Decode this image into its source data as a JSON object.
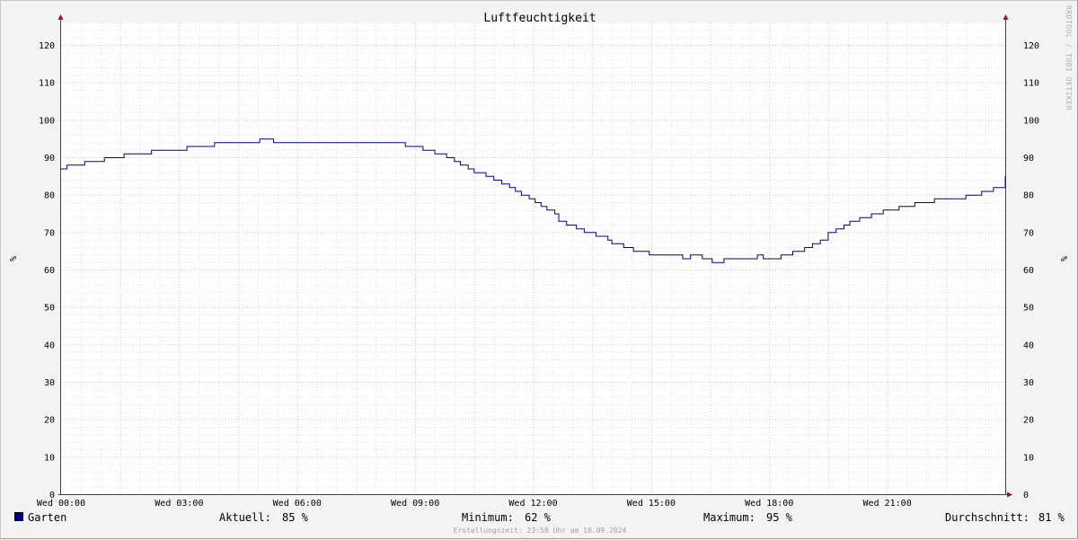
{
  "chart_data": {
    "type": "line",
    "title": "Luftfeuchtigkeit",
    "ylabel": "%",
    "ylim": [
      0,
      126
    ],
    "yticks": [
      0,
      10,
      20,
      30,
      40,
      50,
      60,
      70,
      80,
      90,
      100,
      110,
      120
    ],
    "xlim": [
      0,
      24
    ],
    "xtick_labels": [
      "Wed 00:00",
      "Wed 03:00",
      "Wed 06:00",
      "Wed 09:00",
      "Wed 12:00",
      "Wed 15:00",
      "Wed 18:00",
      "Wed 21:00"
    ],
    "grid": true,
    "series": [
      {
        "name": "Garten",
        "color": "#00008b",
        "x": [
          0,
          0.15,
          0.6,
          1.1,
          1.6,
          2.3,
          3.2,
          3.9,
          5.05,
          5.4,
          8.75,
          9.2,
          9.5,
          9.8,
          10.0,
          10.15,
          10.35,
          10.5,
          10.8,
          11.0,
          11.2,
          11.4,
          11.55,
          11.7,
          11.9,
          12.05,
          12.2,
          12.35,
          12.55,
          12.65,
          12.85,
          13.1,
          13.3,
          13.6,
          13.9,
          14.0,
          14.3,
          14.55,
          14.8,
          14.95,
          15.8,
          16.0,
          16.3,
          16.55,
          16.85,
          16.95,
          17.5,
          17.7,
          17.85,
          18.3,
          18.6,
          18.9,
          19.1,
          19.3,
          19.5,
          19.7,
          19.9,
          20.05,
          20.3,
          20.6,
          20.9,
          21.3,
          21.7,
          22.2,
          23.0,
          23.4,
          23.7,
          24.0
        ],
        "values": [
          87,
          88,
          89,
          90,
          91,
          92,
          93,
          94,
          95,
          94,
          93,
          92,
          91,
          90,
          89,
          88,
          87,
          86,
          85,
          84,
          83,
          82,
          81,
          80,
          79,
          78,
          77,
          76,
          75,
          73,
          72,
          71,
          70,
          69,
          68,
          67,
          66,
          65,
          65,
          64,
          63,
          64,
          63,
          62,
          63,
          63,
          63,
          64,
          63,
          64,
          65,
          66,
          67,
          68,
          70,
          71,
          72,
          73,
          74,
          75,
          76,
          77,
          78,
          79,
          80,
          81,
          82,
          85
        ]
      }
    ]
  },
  "legend": {
    "series_name": "Garten",
    "current_label": "Aktuell:",
    "current_value": "85 %",
    "min_label": "Minimum:",
    "min_value": "62 %",
    "max_label": "Maximum:",
    "max_value": "95 %",
    "avg_label": "Durchschnitt:",
    "avg_value": "81 %"
  },
  "footer_text": "Erstellungszeit: 23:58 Uhr am 18.09.2024",
  "watermark": "RRDTOOL / TOBI OETIKER"
}
